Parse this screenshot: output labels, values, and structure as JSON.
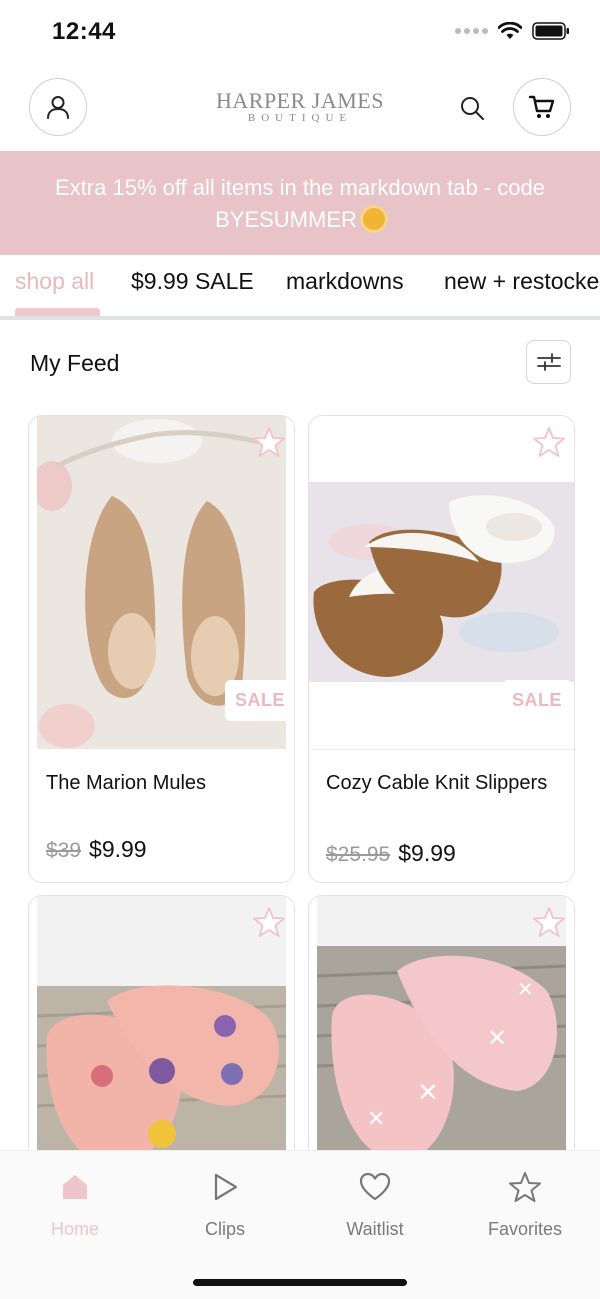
{
  "status_bar": {
    "time": "12:44"
  },
  "header": {
    "logo_main": "HARPER JAMES",
    "logo_sub": "BOUTIQUE",
    "icons": [
      "account-icon",
      "search-icon",
      "cart-icon"
    ]
  },
  "promo": {
    "text": "Extra 15% off all items in the markdown tab - code BYESUMMER",
    "emoji": "sun-icon"
  },
  "tabs": [
    {
      "label": "shop all",
      "active": true
    },
    {
      "label": "$9.99 SALE",
      "active": false
    },
    {
      "label": "markdowns",
      "active": false
    },
    {
      "label": "new + restocke",
      "active": false
    }
  ],
  "feed": {
    "title": "My Feed",
    "filter_icon": "sliders-icon"
  },
  "products": [
    {
      "name": "The Marion Mules",
      "badge": "SALE",
      "old_price": "$39",
      "price": "$9.99"
    },
    {
      "name": "Cozy Cable Knit Slippers",
      "badge": "SALE",
      "old_price": "$25.95",
      "price": "$9.99"
    },
    {
      "name": "",
      "badge": "",
      "old_price": "",
      "price": ""
    },
    {
      "name": "",
      "badge": "",
      "old_price": "",
      "price": ""
    }
  ],
  "bottom_nav": [
    {
      "label": "Home",
      "icon": "home-icon",
      "active": true
    },
    {
      "label": "Clips",
      "icon": "play-icon",
      "active": false
    },
    {
      "label": "Waitlist",
      "icon": "heart-icon",
      "active": false
    },
    {
      "label": "Favorites",
      "icon": "star-icon",
      "active": false
    }
  ],
  "colors": {
    "accent_pink": "#e8c3c7",
    "active_pink": "#f0c5c9",
    "sale_pink": "#eab8be"
  }
}
